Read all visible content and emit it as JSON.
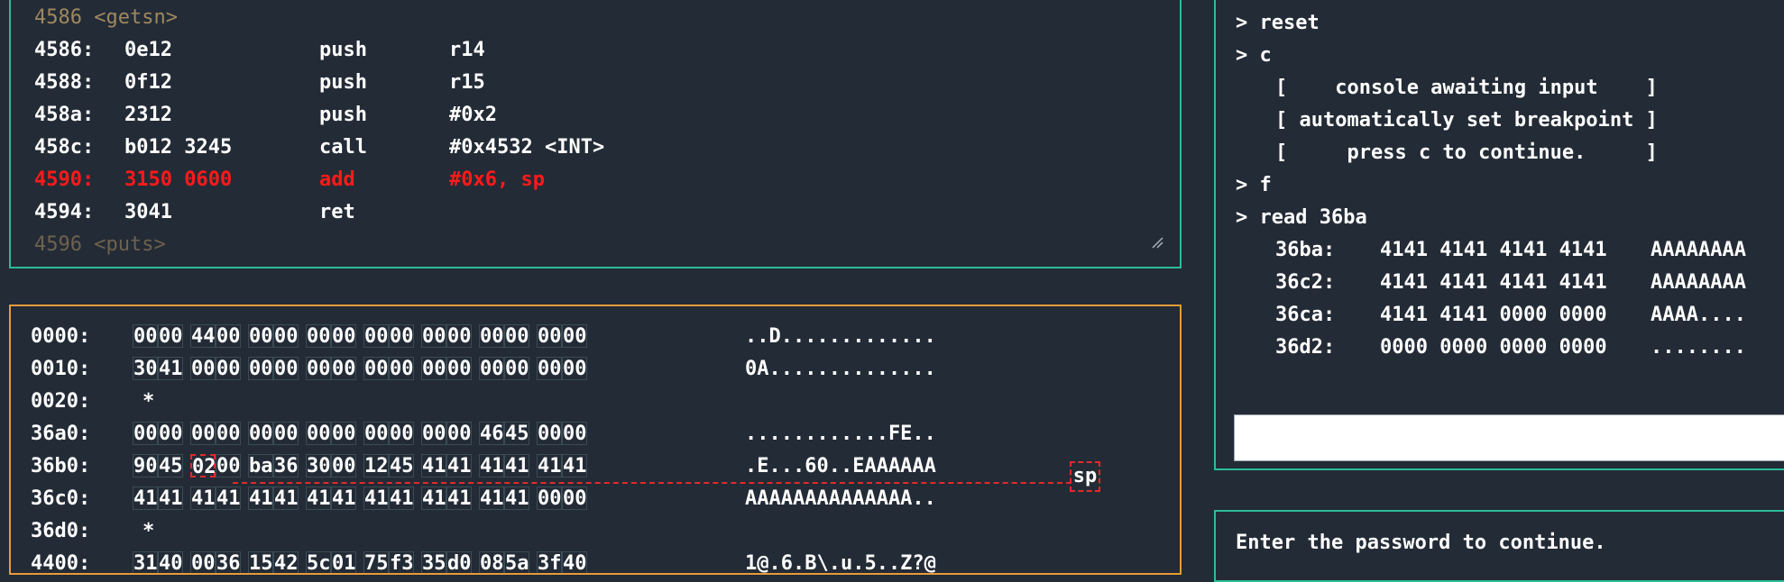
{
  "disassembly": {
    "label": "4586 <getsn>",
    "instructions": [
      {
        "addr": "4586:",
        "bytes": "0e12",
        "op": "push",
        "args": "r14"
      },
      {
        "addr": "4588:",
        "bytes": "0f12",
        "op": "push",
        "args": "r15"
      },
      {
        "addr": "458a:",
        "bytes": "2312",
        "op": "push",
        "args": "#0x2"
      },
      {
        "addr": "458c:",
        "bytes": "b012 3245",
        "op": "call",
        "args": "#0x4532 <INT>"
      },
      {
        "addr": "4590:",
        "bytes": "3150 0600",
        "op": "add",
        "args": "#0x6, sp"
      },
      {
        "addr": "4594:",
        "bytes": "3041",
        "op": "ret",
        "args": ""
      }
    ],
    "next_label": "4596 <puts>",
    "colors": {
      "current": "#ff1a1a",
      "label": "#a0885f",
      "border": "#2bbd98"
    }
  },
  "memory": {
    "rows": [
      {
        "addr": "0000:",
        "bytes": [
          "00",
          "00",
          "44",
          "00",
          "00",
          "00",
          "00",
          "00",
          "00",
          "00",
          "00",
          "00",
          "00",
          "00",
          "00",
          "00"
        ],
        "ascii": "..D............."
      },
      {
        "addr": "0010:",
        "bytes": [
          "30",
          "41",
          "00",
          "00",
          "00",
          "00",
          "00",
          "00",
          "00",
          "00",
          "00",
          "00",
          "00",
          "00",
          "00",
          "00"
        ],
        "ascii": "0A.............."
      },
      {
        "addr": "0020:",
        "star": "*"
      },
      {
        "addr": "36a0:",
        "bytes": [
          "00",
          "00",
          "00",
          "00",
          "00",
          "00",
          "00",
          "00",
          "00",
          "00",
          "00",
          "00",
          "46",
          "45",
          "00",
          "00"
        ],
        "ascii": "............FE.."
      },
      {
        "addr": "36b0:",
        "bytes": [
          "90",
          "45",
          "02",
          "00",
          "ba",
          "36",
          "30",
          "00",
          "12",
          "45",
          "41",
          "41",
          "41",
          "41",
          "41",
          "41"
        ],
        "ascii": ".E...60..EAAAAAA"
      },
      {
        "addr": "36c0:",
        "bytes": [
          "41",
          "41",
          "41",
          "41",
          "41",
          "41",
          "41",
          "41",
          "41",
          "41",
          "41",
          "41",
          "41",
          "41",
          "00",
          "00"
        ],
        "ascii": "AAAAAAAAAAAAAA.."
      },
      {
        "addr": "36d0:",
        "star": "*"
      },
      {
        "addr": "4400:",
        "bytes": [
          "31",
          "40",
          "00",
          "36",
          "15",
          "42",
          "5c",
          "01",
          "75",
          "f3",
          "35",
          "d0",
          "08",
          "5a",
          "3f",
          "40"
        ],
        "ascii": "1@.6.B\\.u.5..Z?@"
      }
    ],
    "sp_label": "sp",
    "border_color": "#e79a3a",
    "highlight_color": "#e32a2a"
  },
  "console": {
    "lines": [
      {
        "kind": "cmd",
        "text": "> reset"
      },
      {
        "kind": "cmd",
        "text": "> c"
      },
      {
        "kind": "msg",
        "text": "[    console awaiting input    ]"
      },
      {
        "kind": "msg",
        "text": "[ automatically set breakpoint ]"
      },
      {
        "kind": "msg",
        "text": "[     press c to continue.     ]"
      },
      {
        "kind": "cmd",
        "text": "> f"
      },
      {
        "kind": "cmd",
        "text": "> read 36ba"
      }
    ],
    "dump": [
      {
        "addr": "36ba:",
        "hex": "4141 4141 4141 4141",
        "ascii": "AAAAAAAA"
      },
      {
        "addr": "36c2:",
        "hex": "4141 4141 4141 4141",
        "ascii": "AAAAAAAA"
      },
      {
        "addr": "36ca:",
        "hex": "4141 4141 0000 0000",
        "ascii": "AAAA...."
      },
      {
        "addr": "36d2:",
        "hex": "0000 0000 0000 0000",
        "ascii": "........"
      }
    ],
    "input_value": ""
  },
  "message": {
    "text": "Enter the password to continue."
  }
}
